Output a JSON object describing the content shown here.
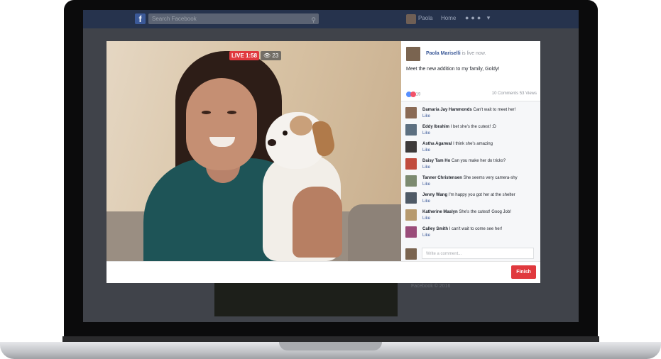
{
  "topbar": {
    "logo": "f",
    "search_placeholder": "Search Facebook",
    "user_name": "Paola",
    "home_label": "Home"
  },
  "video": {
    "live_label": "LIVE 1:58",
    "viewer_count": "👁 23"
  },
  "post": {
    "poster_name": "Paola Mariselli",
    "status_suffix": " is live now.",
    "text": "Meet the new addition to my family, Goldy!",
    "reaction_count": "19",
    "stats": "10 Comments  53 Views"
  },
  "comments": [
    {
      "name": "Damaria Jay Hammonds",
      "text": " Can't wait to meet her!",
      "like": "Like",
      "color": "#8a6a55"
    },
    {
      "name": "Eddy Ibrahim",
      "text": " I bet she's the cutest! :D",
      "like": "Like",
      "color": "#5c6f80"
    },
    {
      "name": "Astha Agarwal",
      "text": " I think she's amazing",
      "like": "Like",
      "color": "#3d3a3a"
    },
    {
      "name": "Daisy Tam Ho",
      "text": " Can you make her do tricks?",
      "like": "Like",
      "color": "#c14c3e"
    },
    {
      "name": "Tanner Christensen",
      "text": " She seems very camera-shy",
      "like": "Like",
      "color": "#7c8a70"
    },
    {
      "name": "Jenny Wang",
      "text": " I'm happy you got her at the shelter",
      "like": "Like",
      "color": "#4f5a66"
    },
    {
      "name": "Katherine Maslyn",
      "text": " She's the cutest! Goog Job!",
      "like": "Like",
      "color": "#b79a6e"
    },
    {
      "name": "Calley Smith",
      "text": " I can't wait to come see her!",
      "like": "Like",
      "color": "#9a4c7a"
    }
  ],
  "composer": {
    "placeholder": "Write a comment..."
  },
  "actions": {
    "finish_label": "Finish"
  },
  "background": {
    "side_line1": "Facebook © 2016"
  }
}
